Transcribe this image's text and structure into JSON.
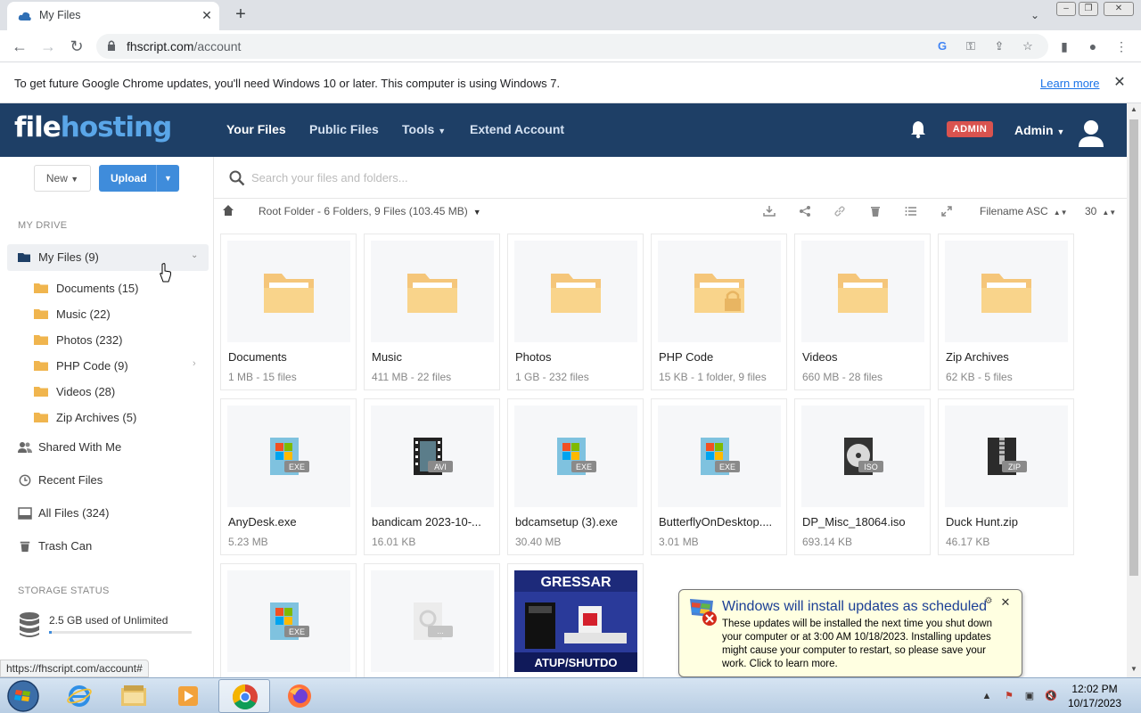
{
  "browser": {
    "tab_title": "My Files",
    "url_host": "fhscript.com",
    "url_path": "/account",
    "infobar_text": "To get future Google Chrome updates, you'll need Windows 10 or later. This computer is using Windows 7.",
    "infobar_link": "Learn more",
    "status_url": "https://fhscript.com/account#"
  },
  "header": {
    "logo_part1": "file",
    "logo_part2": "hosting",
    "nav": [
      "Your Files",
      "Public Files",
      "Tools",
      "Extend Account"
    ],
    "admin_badge": "ADMIN",
    "admin_name": "Admin"
  },
  "sidebar": {
    "new_label": "New",
    "upload_label": "Upload",
    "my_drive_heading": "MY DRIVE",
    "my_files": "My Files (9)",
    "folders": [
      "Documents (15)",
      "Music (22)",
      "Photos (232)",
      "PHP Code (9)",
      "Videos (28)",
      "Zip Archives (5)"
    ],
    "links": [
      "Shared With Me",
      "Recent Files",
      "All Files (324)",
      "Trash Can"
    ],
    "storage_heading": "STORAGE STATUS",
    "storage_text": "2.5 GB used of Unlimited",
    "storage_fraction": 0.02
  },
  "main": {
    "search_placeholder": "Search your files and folders...",
    "breadcrumb": "Root Folder - 6 Folders, 9 Files (103.45 MB)",
    "sort_label": "Filename ASC",
    "per_page": "30",
    "folders": [
      {
        "name": "Documents",
        "meta": "1 MB - 15 files"
      },
      {
        "name": "Music",
        "meta": "411 MB - 22 files"
      },
      {
        "name": "Photos",
        "meta": "1 GB - 232 files"
      },
      {
        "name": "PHP Code",
        "meta": "15 KB - 1 folder, 9 files"
      },
      {
        "name": "Videos",
        "meta": "660 MB - 28 files"
      },
      {
        "name": "Zip Archives",
        "meta": "62 KB - 5 files"
      }
    ],
    "files": [
      {
        "name": "AnyDesk.exe",
        "meta": "5.23 MB",
        "ext": "EXE"
      },
      {
        "name": "bandicam 2023-10-...",
        "meta": "16.01 KB",
        "ext": "AVI"
      },
      {
        "name": "bdcamsetup (3).exe",
        "meta": "30.40 MB",
        "ext": "EXE"
      },
      {
        "name": "ButterflyOnDesktop....",
        "meta": "3.01 MB",
        "ext": "EXE"
      },
      {
        "name": "DP_Misc_18064.iso",
        "meta": "693.14 KB",
        "ext": "ISO"
      },
      {
        "name": "Duck Hunt.zip",
        "meta": "46.17 KB",
        "ext": "ZIP"
      }
    ],
    "row3": [
      {
        "ext": "EXE"
      },
      {
        "ext": "..."
      },
      {
        "image_text_top": "GRESSAR",
        "image_text_bottom": "ATUP/SHUTDO"
      }
    ]
  },
  "notification": {
    "title": "Windows will install updates as scheduled",
    "body": "These updates will be installed the next time you shut down your computer or at 3:00 AM 10/18/2023. Installing updates might cause your computer to restart, so please save your work. Click to learn more."
  },
  "taskbar": {
    "time": "12:02 PM",
    "date": "10/17/2023"
  }
}
